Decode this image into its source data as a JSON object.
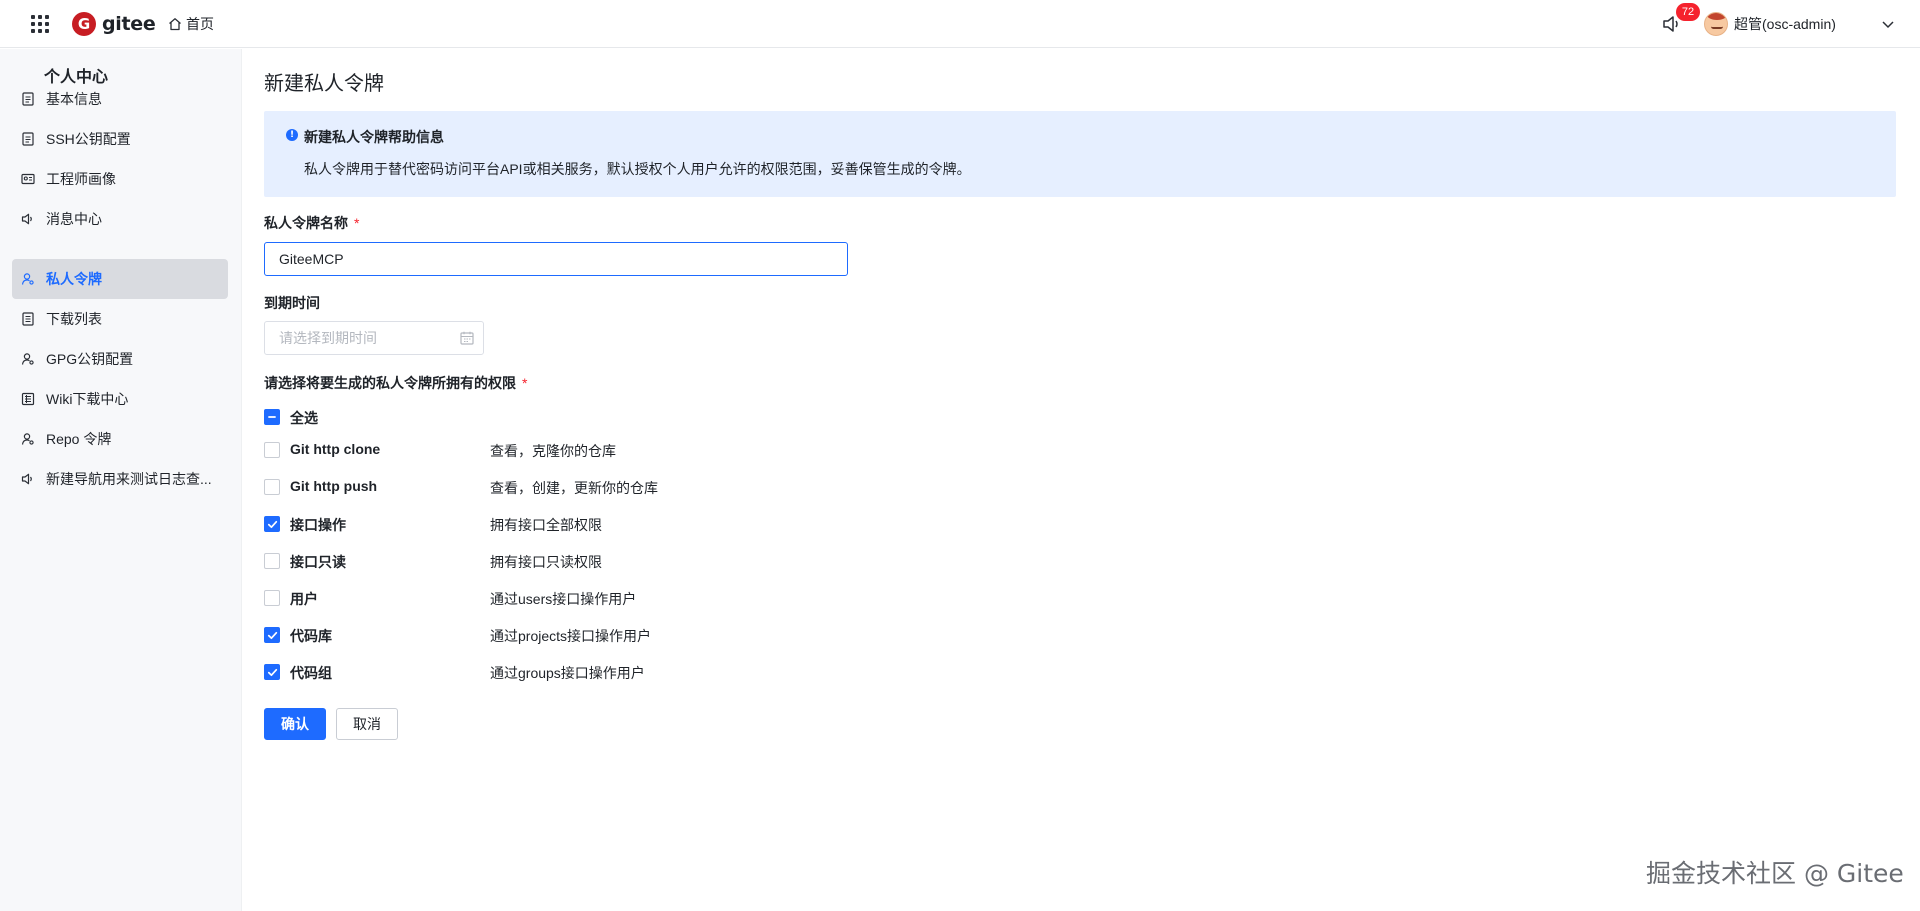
{
  "header": {
    "logo_text": "gitee",
    "logo_mark": "G",
    "home_label": "首页",
    "notification_count": "72",
    "user_name": "超管(osc-admin)"
  },
  "sidebar": {
    "title": "个人中心",
    "items": [
      {
        "label": "基本信息",
        "icon": "doc-icon"
      },
      {
        "label": "SSH公钥配置",
        "icon": "doc-icon"
      },
      {
        "label": "工程师画像",
        "icon": "id-card-icon"
      },
      {
        "label": "消息中心",
        "icon": "speaker-icon"
      },
      {
        "label": "私人令牌",
        "icon": "user-key-icon",
        "active": true
      },
      {
        "label": "下载列表",
        "icon": "list-icon"
      },
      {
        "label": "GPG公钥配置",
        "icon": "user-key-icon"
      },
      {
        "label": "Wiki下载中心",
        "icon": "grid-doc-icon"
      },
      {
        "label": "Repo 令牌",
        "icon": "user-key-icon"
      },
      {
        "label": "新建导航用来测试日志查...",
        "icon": "speaker-icon"
      }
    ]
  },
  "main": {
    "title": "新建私人令牌",
    "info": {
      "title": "新建私人令牌帮助信息",
      "description": "私人令牌用于替代密码访问平台API或相关服务，默认授权个人用户允许的权限范围，妥善保管生成的令牌。"
    },
    "name_field": {
      "label": "私人令牌名称",
      "required_mark": "*",
      "value": "GiteeMCP"
    },
    "expire_field": {
      "label": "到期时间",
      "placeholder": "请选择到期时间"
    },
    "permissions": {
      "label": "请选择将要生成的私人令牌所拥有的权限",
      "required_mark": "*",
      "select_all_label": "全选",
      "select_all_state": "indeterminate",
      "items": [
        {
          "name": "Git http clone",
          "desc": "查看，克隆你的仓库",
          "checked": false
        },
        {
          "name": "Git http push",
          "desc": "查看，创建，更新你的仓库",
          "checked": false
        },
        {
          "name": "接口操作",
          "desc": "拥有接口全部权限",
          "checked": true
        },
        {
          "name": "接口只读",
          "desc": "拥有接口只读权限",
          "checked": false
        },
        {
          "name": "用户",
          "desc": "通过users接口操作用户",
          "checked": false
        },
        {
          "name": "代码库",
          "desc": "通过projects接口操作用户",
          "checked": true
        },
        {
          "name": "代码组",
          "desc": "通过groups接口操作用户",
          "checked": true
        }
      ]
    },
    "actions": {
      "confirm_label": "确认",
      "cancel_label": "取消"
    }
  },
  "watermark": "掘金技术社区 @ Gitee",
  "colors": {
    "accent": "#1e6bff",
    "required": "#f5222d",
    "brand": "#c71d23",
    "info_bg": "#e6efff"
  }
}
